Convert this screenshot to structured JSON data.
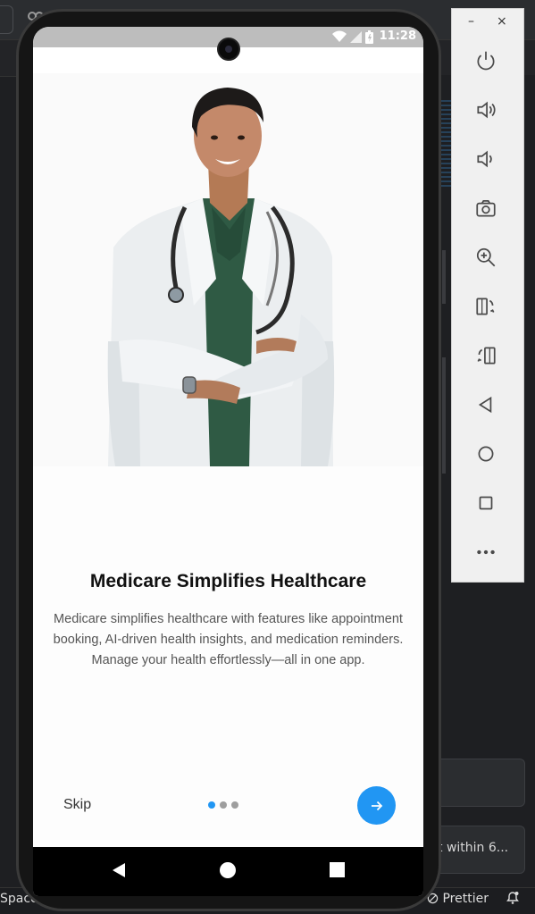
{
  "ide": {
    "status_left": "Space:",
    "status_prettier": "Prettier",
    "notification_text": "t within 6..."
  },
  "emulator": {
    "minimize": "–",
    "close": "×",
    "tools": [
      {
        "name": "power-icon"
      },
      {
        "name": "volume-up-icon"
      },
      {
        "name": "volume-down-icon"
      },
      {
        "name": "camera-icon"
      },
      {
        "name": "zoom-in-icon"
      },
      {
        "name": "rotate-left-icon"
      },
      {
        "name": "rotate-right-icon"
      },
      {
        "name": "back-icon"
      },
      {
        "name": "home-icon"
      },
      {
        "name": "overview-icon"
      },
      {
        "name": "more-icon"
      }
    ]
  },
  "phone": {
    "status_time": "11:28",
    "onboarding": {
      "title": "Medicare Simplifies Healthcare",
      "description": "Medicare simplifies healthcare with features like appointment booking, AI-driven health insights, and medication reminders. Manage your health effortlessly—all in one app.",
      "skip_label": "Skip",
      "page_count": 3,
      "current_page": 1
    }
  },
  "colors": {
    "accent": "#2196f3",
    "dot_inactive": "#9e9e9e"
  }
}
